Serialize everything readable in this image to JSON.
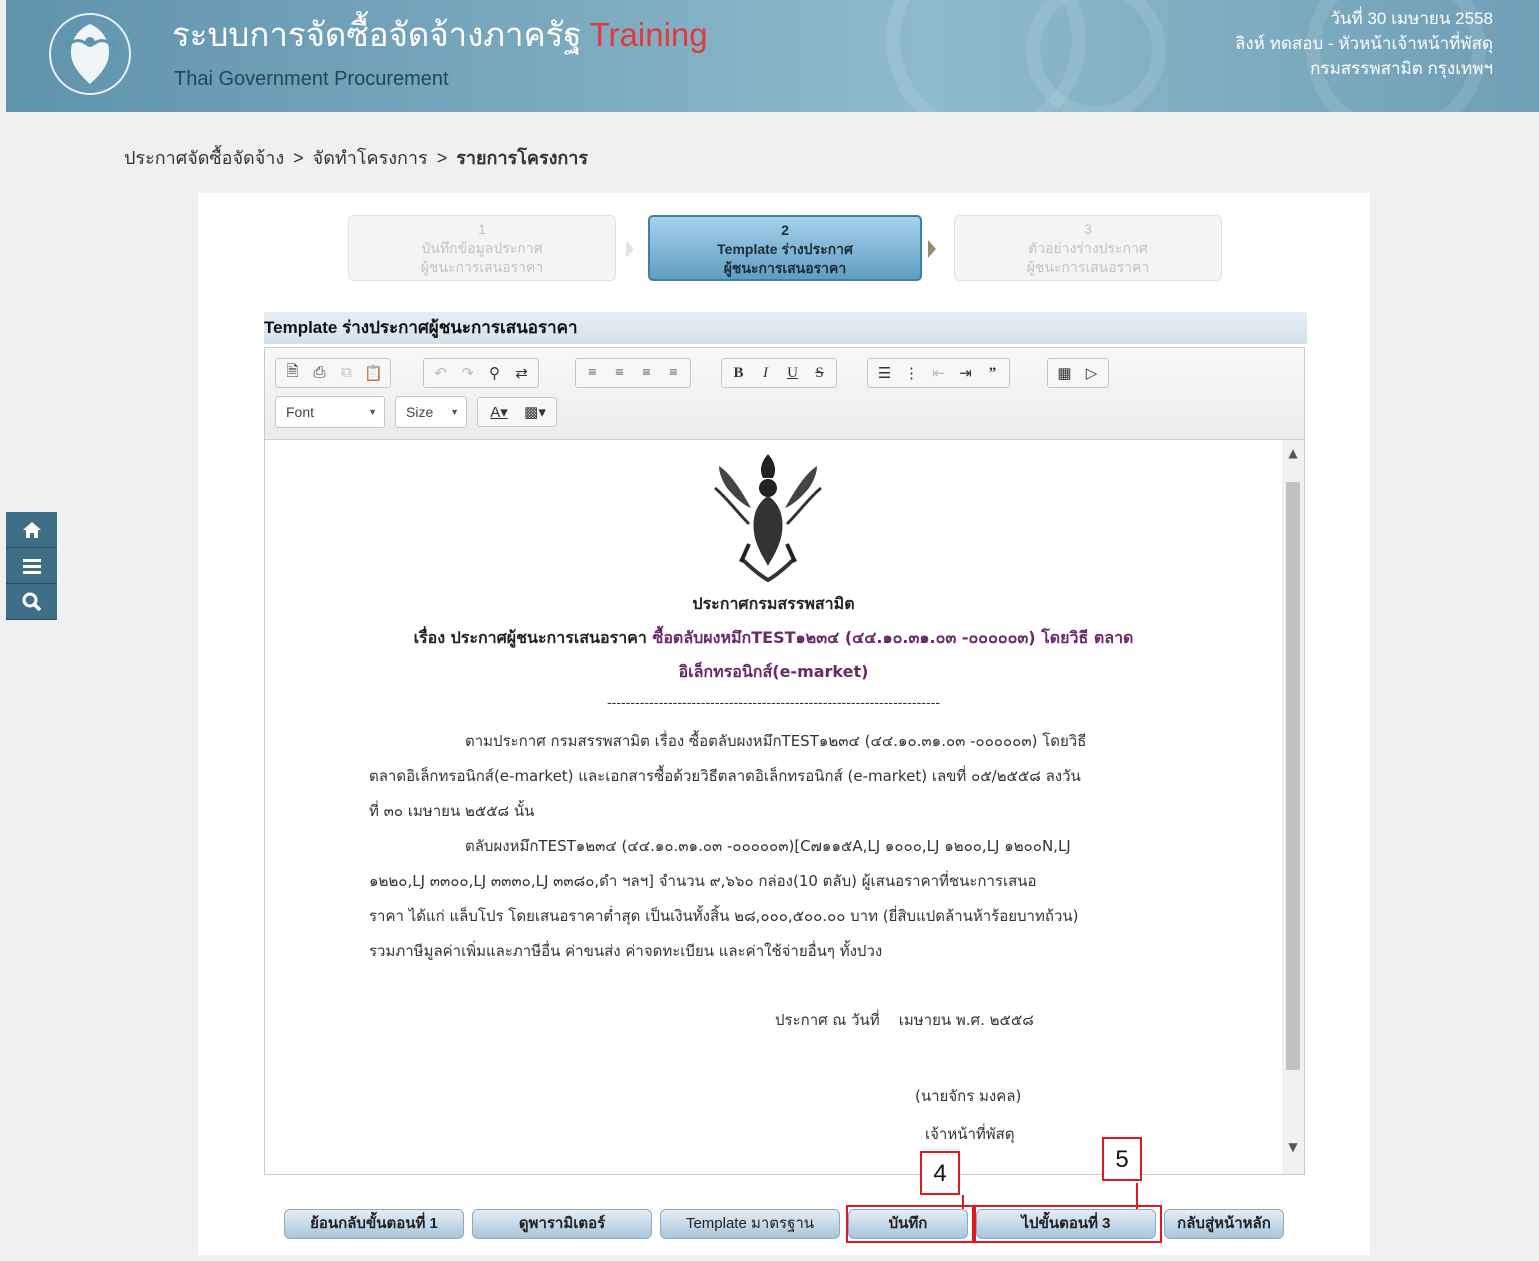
{
  "header": {
    "title": "ระบบการจัดซื้อจัดจ้างภาครัฐ",
    "title_badge": "Training",
    "subtitle": "Thai Government Procurement",
    "date": "วันที่ 30 เมษายน 2558",
    "user": "ลิงห์ ทดสอบ - หัวหน้าเจ้าหน้าที่พัสดุ",
    "department": "กรมสรรพสามิต กรุงเทพฯ"
  },
  "breadcrumb": {
    "item1": "ประกาศจัดซื้อจัดจ้าง",
    "item2": "จัดทำโครงการ",
    "item3": "รายการโครงการ",
    "separator": ">"
  },
  "steps": [
    {
      "number": "1",
      "line1": "บันทึกข้อมูลประกาศ",
      "line2": "ผู้ชนะการเสนอราคา"
    },
    {
      "number": "2",
      "line1": "Template ร่างประกาศ",
      "line2": "ผู้ชนะการเสนอราคา"
    },
    {
      "number": "3",
      "line1": "ตัวอย่างร่างประกาศ",
      "line2": "ผู้ชนะการเสนอราคา"
    }
  ],
  "editor": {
    "title": "Template ร่างประกาศผู้ชนะการเสนอราคา",
    "font_label": "Font",
    "size_label": "Size"
  },
  "document": {
    "org": "ประกาศกรมสรรพสามิต",
    "subject_prefix": "เรื่อง ประกาศผู้ชนะการเสนอราคา",
    "subject_item": "ซื้อตลับผงหมึกTEST๑๒๓๔ (๔๔.๑๐.๓๑.๐๓ -๐๐๐๐๐๓) โดยวิธี ตลาด",
    "subject_line2": "อิเล็กทรอนิกส์(e-market)",
    "divider": "-----------------------------------------------------------------------",
    "p1_l1": "ตามประกาศ กรมสรรพสามิต เรื่อง ซื้อตลับผงหมึกTEST๑๒๓๔ (๔๔.๑๐.๓๑.๐๓ -๐๐๐๐๐๓) โดยวิธี",
    "p1_l2": "ตลาดอิเล็กทรอนิกส์(e-market) และเอกสารซื้อด้วยวิธีตลาดอิเล็กทรอนิกส์ (e-market) เลขที่ ๐๕/๒๕๕๘ ลงวัน",
    "p1_l3": "ที่ ๓๐ เมษายน ๒๕๕๘ นั้น",
    "p2_l1": "ตลับผงหมึกTEST๑๒๓๔ (๔๔.๑๐.๓๑.๐๓ -๐๐๐๐๐๓)[C๗๑๑๕A,LJ ๑๐๐๐,LJ ๑๒๐๐,LJ ๑๒๐๐N,LJ",
    "p2_l2": "๑๒๒๐,LJ ๓๓๐๐,LJ ๓๓๓๐,LJ ๓๓๘๐,ดำ ฯลฯ] จำนวน ๙,๖๖๐ กล่อง(10 ตลับ) ผู้เสนอราคาที่ชนะการเสนอ",
    "p2_l3": "ราคา ได้แก่ แล็บโปร โดยเสนอราคาต่ำสุด เป็นเงินทั้งสิ้น ๒๘,๐๐๐,๕๐๐.๐๐ บาท (ยี่สิบแปดล้านห้าร้อยบาทถ้วน)",
    "p2_l4": "รวมภาษีมูลค่าเพิ่มและภาษีอื่น ค่าขนส่ง ค่าจดทะเบียน และค่าใช้จ่ายอื่นๆ ทั้งปวง",
    "announce_date": "ประกาศ ณ วันที่    เมษายน พ.ศ. ๒๕๕๘",
    "signer_name": "(นายจักร มงคล)",
    "signer_title": "เจ้าหน้าที่พัสดุ"
  },
  "buttons": {
    "back_step1": "ย้อนกลับขั้นตอนที่ 1",
    "view_params": "ดูพารามิเตอร์",
    "standard_template": "Template มาตรฐาน",
    "save": "บันทึก",
    "next_step3": "ไปขั้นตอนที่ 3",
    "home": "กลับสู่หน้าหลัก"
  },
  "markers": {
    "save_marker": "4",
    "next_marker": "5"
  },
  "colors": {
    "header": "#6d9fb6",
    "training": "#e5383b",
    "annotation": "#e0191f",
    "active_step": "#5f9dc2"
  },
  "icons": [
    "home-icon",
    "menu-icon",
    "search-icon"
  ]
}
